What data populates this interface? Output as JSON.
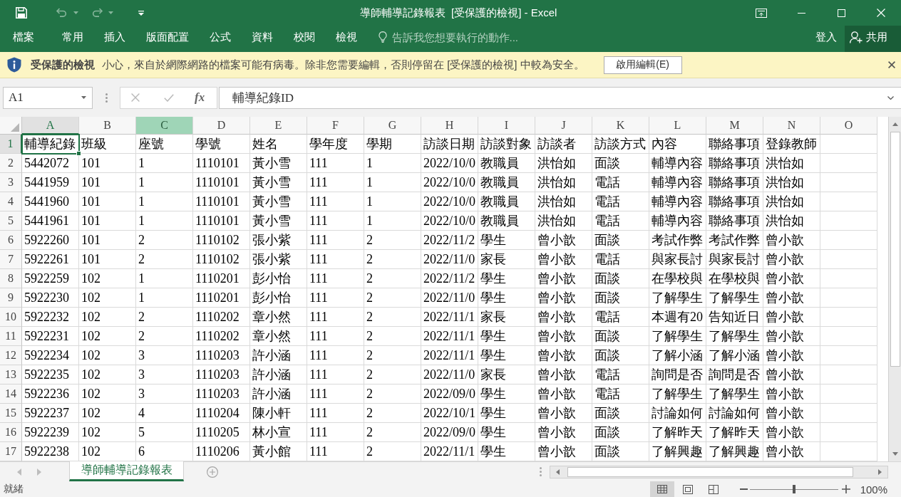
{
  "title_bar": {
    "title": "導師輔導記錄報表  [受保護的檢視] - Excel",
    "quick_access": [
      {
        "kind": "save",
        "disabled": false
      },
      {
        "kind": "undo",
        "disabled": true
      },
      {
        "kind": "redo",
        "disabled": true
      },
      {
        "kind": "customize",
        "disabled": false
      }
    ]
  },
  "ribbon": {
    "tabs": [
      {
        "label": "檔案",
        "selected": false
      },
      {
        "label": "常用",
        "selected": false
      },
      {
        "label": "插入",
        "selected": false
      },
      {
        "label": "版面配置",
        "selected": false
      },
      {
        "label": "公式",
        "selected": false
      },
      {
        "label": "資料",
        "selected": false
      },
      {
        "label": "校閱",
        "selected": false
      },
      {
        "label": "檢視",
        "selected": false
      }
    ],
    "tell_me": {
      "placeholder": "告訴我您想要執行的動作..."
    },
    "sign_in": "登入",
    "share": "共用"
  },
  "message_bar": {
    "title": "受保護的檢視",
    "message": "小心，來自於網際網路的檔案可能有病毒。除非您需要編輯，否則停留在 [受保護的檢視] 中較為安全。",
    "button": "啟用編輯(E)"
  },
  "formula_bar": {
    "name_box": "A1",
    "cancel": {
      "disabled": true
    },
    "enter": {
      "disabled": true
    },
    "function_label": "fx",
    "formula": "輔導紀錄ID"
  },
  "sheet": {
    "columns": [
      {
        "label": "A",
        "selected": true,
        "highlighted": false
      },
      {
        "label": "B",
        "selected": false,
        "highlighted": false
      },
      {
        "label": "C",
        "selected": false,
        "highlighted": true
      },
      {
        "label": "D",
        "selected": false,
        "highlighted": false
      },
      {
        "label": "E",
        "selected": false,
        "highlighted": false
      },
      {
        "label": "F",
        "selected": false,
        "highlighted": false
      },
      {
        "label": "G",
        "selected": false,
        "highlighted": false
      },
      {
        "label": "H",
        "selected": false,
        "highlighted": false
      },
      {
        "label": "I",
        "selected": false,
        "highlighted": false
      },
      {
        "label": "J",
        "selected": false,
        "highlighted": false
      },
      {
        "label": "K",
        "selected": false,
        "highlighted": false
      },
      {
        "label": "L",
        "selected": false,
        "highlighted": false
      },
      {
        "label": "M",
        "selected": false,
        "highlighted": false
      },
      {
        "label": "N",
        "selected": false,
        "highlighted": false
      },
      {
        "label": "O",
        "selected": false,
        "highlighted": false
      }
    ],
    "rows": [
      {
        "label": "1",
        "selected": true,
        "cells": [
          "輔導紀錄",
          "班級",
          "座號",
          "學號",
          "姓名",
          "學年度",
          "學期",
          "訪談日期",
          "訪談對象",
          "訪談者",
          "訪談方式",
          "內容",
          "聯絡事項",
          "登錄教師"
        ]
      },
      {
        "label": "2",
        "selected": false,
        "cells": [
          "5442072",
          "101",
          "1",
          "1110101",
          "黃小雪",
          "111",
          "1",
          "2022/10/0",
          "教職員",
          "洪怡如",
          "面談",
          "輔導內容",
          "聯絡事項",
          "洪怡如"
        ]
      },
      {
        "label": "3",
        "selected": false,
        "cells": [
          "5441959",
          "101",
          "1",
          "1110101",
          "黃小雪",
          "111",
          "1",
          "2022/10/0",
          "教職員",
          "洪怡如",
          "電話",
          "輔導內容",
          "聯絡事項",
          "洪怡如"
        ]
      },
      {
        "label": "4",
        "selected": false,
        "cells": [
          "5441960",
          "101",
          "1",
          "1110101",
          "黃小雪",
          "111",
          "1",
          "2022/10/0",
          "教職員",
          "洪怡如",
          "電話",
          "輔導內容",
          "聯絡事項",
          "洪怡如"
        ]
      },
      {
        "label": "5",
        "selected": false,
        "cells": [
          "5441961",
          "101",
          "1",
          "1110101",
          "黃小雪",
          "111",
          "1",
          "2022/10/0",
          "教職員",
          "洪怡如",
          "電話",
          "輔導內容",
          "聯絡事項",
          "洪怡如"
        ]
      },
      {
        "label": "6",
        "selected": false,
        "cells": [
          "5922260",
          "101",
          "2",
          "1110102",
          "張小紫",
          "111",
          "2",
          "2022/11/2",
          "學生",
          "曾小歆",
          "面談",
          "考試作弊",
          "考試作弊",
          "曾小歆"
        ]
      },
      {
        "label": "7",
        "selected": false,
        "cells": [
          "5922261",
          "101",
          "2",
          "1110102",
          "張小紫",
          "111",
          "2",
          "2022/11/0",
          "家長",
          "曾小歆",
          "電話",
          "與家長討",
          "與家長討",
          "曾小歆"
        ]
      },
      {
        "label": "8",
        "selected": false,
        "cells": [
          "5922259",
          "102",
          "1",
          "1110201",
          "彭小怡",
          "111",
          "2",
          "2022/11/2",
          "學生",
          "曾小歆",
          "面談",
          "在學校與",
          "在學校與",
          "曾小歆"
        ]
      },
      {
        "label": "9",
        "selected": false,
        "cells": [
          "5922230",
          "102",
          "1",
          "1110201",
          "彭小怡",
          "111",
          "2",
          "2022/11/0",
          "學生",
          "曾小歆",
          "面談",
          "了解學生",
          "了解學生",
          "曾小歆"
        ]
      },
      {
        "label": "10",
        "selected": false,
        "cells": [
          "5922232",
          "102",
          "2",
          "1110202",
          "章小然",
          "111",
          "2",
          "2022/11/1",
          "家長",
          "曾小歆",
          "電話",
          "本週有20",
          "告知近日",
          "曾小歆"
        ]
      },
      {
        "label": "11",
        "selected": false,
        "cells": [
          "5922231",
          "102",
          "2",
          "1110202",
          "章小然",
          "111",
          "2",
          "2022/11/1",
          "學生",
          "曾小歆",
          "面談",
          "了解學生",
          "了解學生",
          "曾小歆"
        ]
      },
      {
        "label": "12",
        "selected": false,
        "cells": [
          "5922234",
          "102",
          "3",
          "1110203",
          "許小涵",
          "111",
          "2",
          "2022/11/1",
          "學生",
          "曾小歆",
          "面談",
          "了解小涵",
          "了解小涵",
          "曾小歆"
        ]
      },
      {
        "label": "13",
        "selected": false,
        "cells": [
          "5922235",
          "102",
          "3",
          "1110203",
          "許小涵",
          "111",
          "2",
          "2022/11/0",
          "家長",
          "曾小歆",
          "電話",
          "詢問是否",
          "詢問是否",
          "曾小歆"
        ]
      },
      {
        "label": "14",
        "selected": false,
        "cells": [
          "5922236",
          "102",
          "3",
          "1110203",
          "許小涵",
          "111",
          "2",
          "2022/09/0",
          "學生",
          "曾小歆",
          "電話",
          "了解學生",
          "了解學生",
          "曾小歆"
        ]
      },
      {
        "label": "15",
        "selected": false,
        "cells": [
          "5922237",
          "102",
          "4",
          "1110204",
          "陳小軒",
          "111",
          "2",
          "2022/10/1",
          "學生",
          "曾小歆",
          "面談",
          "討論如何",
          "討論如何",
          "曾小歆"
        ]
      },
      {
        "label": "16",
        "selected": false,
        "cells": [
          "5922239",
          "102",
          "5",
          "1110205",
          "林小宣",
          "111",
          "2",
          "2022/09/0",
          "學生",
          "曾小歆",
          "面談",
          "了解昨天",
          "了解昨天",
          "曾小歆"
        ]
      },
      {
        "label": "17",
        "selected": false,
        "cells": [
          "5922238",
          "102",
          "6",
          "1110206",
          "黃小館",
          "111",
          "2",
          "2022/11/1",
          "學生",
          "曾小歆",
          "面談",
          "了解興趣",
          "了解興趣",
          "曾小歆"
        ]
      }
    ]
  },
  "sheet_tabs": [
    {
      "label": "導師輔導記錄報表",
      "selected": true
    }
  ],
  "status_bar": {
    "status": "就緒",
    "views": [
      {
        "kind": "normal",
        "selected": true
      },
      {
        "kind": "page_layout",
        "selected": false
      },
      {
        "kind": "page_break_preview",
        "selected": false
      }
    ],
    "zoom": {
      "level": 0.5,
      "reading": "100%"
    }
  }
}
